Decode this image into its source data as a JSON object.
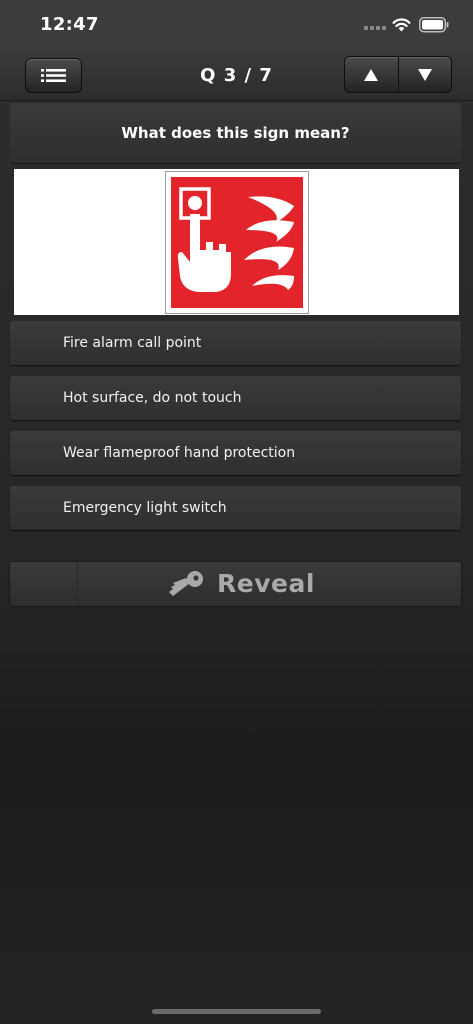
{
  "status_bar": {
    "time": "12:47"
  },
  "nav": {
    "title": "Q 3 / 7"
  },
  "question": {
    "text": "What does this sign mean?"
  },
  "answers": [
    {
      "label": "Fire alarm call point"
    },
    {
      "label": "Hot surface, do not touch"
    },
    {
      "label": "Wear flameproof hand protection"
    },
    {
      "label": "Emergency light switch"
    }
  ],
  "reveal": {
    "label": "Reveal",
    "icon": "key-icon"
  },
  "icons": {
    "menu": "list-icon",
    "up": "triangle-up-icon",
    "down": "triangle-down-icon",
    "sign": "fire-alarm-call-point-sign"
  },
  "colors": {
    "sign_red": "#e3242b"
  }
}
